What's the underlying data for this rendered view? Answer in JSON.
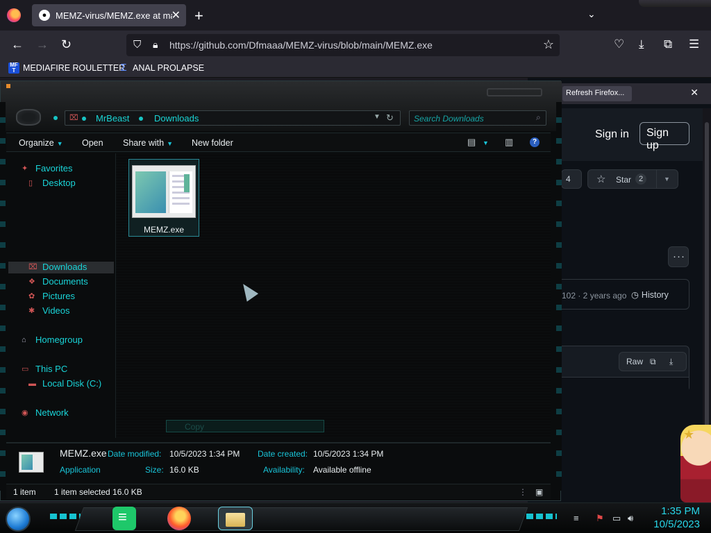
{
  "browser": {
    "tab_title": "MEMZ-virus/MEMZ.exe at main",
    "url": "https://github.com/Dfmaaa/MEMZ-virus/blob/main/MEMZ.exe",
    "bookmarks": [
      "MEDIAFIRE ROULETTER",
      "ANAL PROLAPSE"
    ],
    "bookmark1_icon_text": "MF T"
  },
  "github": {
    "refresh_label": "Refresh Firefox...",
    "sign_in": "Sign in",
    "sign_up": "Sign up",
    "fork_count": "4",
    "star_label": "Star",
    "star_count": "2",
    "commit_meta": "102 · 2 years ago",
    "history_label": "History",
    "raw_label": "Raw"
  },
  "explorer": {
    "breadcrumb": [
      "MrBeast",
      "Downloads"
    ],
    "search_placeholder": "Search Downloads",
    "commands": {
      "organize": "Organize",
      "open": "Open",
      "share_with": "Share with",
      "new_folder": "New folder"
    },
    "nav": {
      "favorites": "Favorites",
      "desktop": "Desktop",
      "downloads": "Downloads",
      "documents": "Documents",
      "pictures": "Pictures",
      "videos": "Videos",
      "homegroup": "Homegroup",
      "this_pc": "This PC",
      "local_disk": "Local Disk (C:)",
      "network": "Network"
    },
    "file": {
      "name": "MEMZ.exe"
    },
    "ghost_label": "Copy",
    "details": {
      "name": "MEMZ.exe",
      "type": "Application",
      "date_modified_label": "Date modified:",
      "date_modified": "10/5/2023 1:34 PM",
      "size_label": "Size:",
      "size": "16.0 KB",
      "date_created_label": "Date created:",
      "date_created": "10/5/2023 1:34 PM",
      "availability_label": "Availability:",
      "availability": "Available offline"
    },
    "status": {
      "items": "1 item",
      "selected": "1 item selected  16.0 KB"
    }
  },
  "taskbar": {
    "time": "1:35 PM",
    "date": "10/5/2023"
  }
}
